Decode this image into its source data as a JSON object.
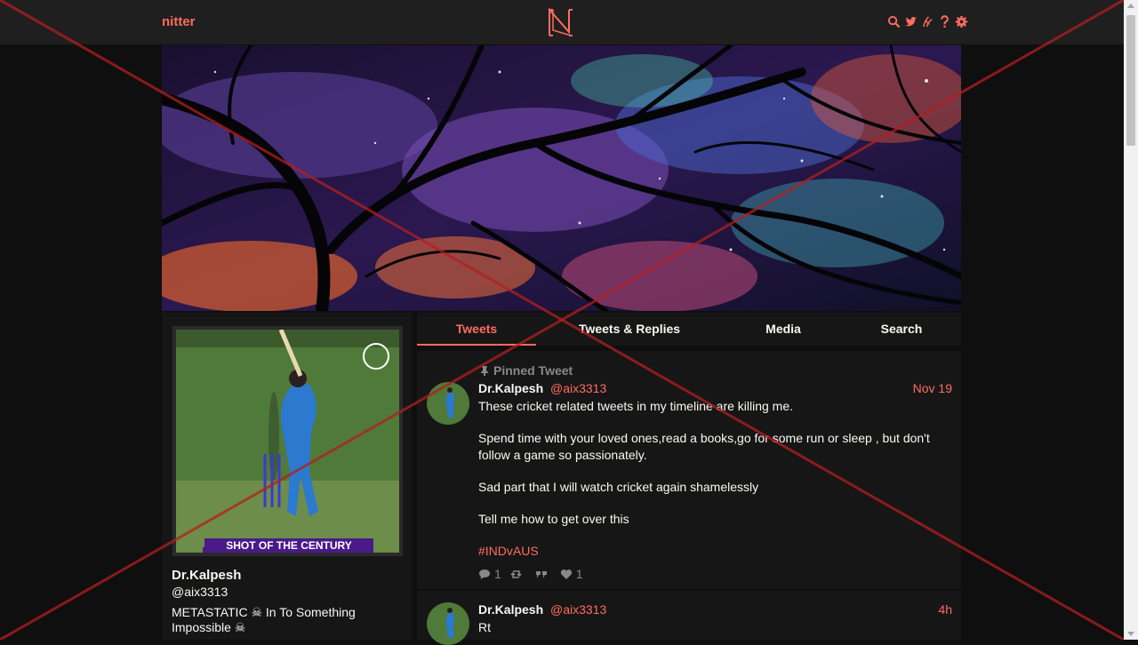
{
  "nav": {
    "brand": "nitter",
    "icons": [
      "search-icon",
      "twitter-icon",
      "rss-icon",
      "help-icon",
      "gear-icon"
    ]
  },
  "profile": {
    "fullname": "Dr.Kalpesh",
    "username": "@aix3313",
    "bio": "METASTATIC ☠ In To Something Impossible ☠",
    "avatar_caption": "SHOT OF THE CENTURY"
  },
  "tabs": [
    {
      "label": "Tweets",
      "active": true
    },
    {
      "label": "Tweets & Replies",
      "active": false
    },
    {
      "label": "Media",
      "active": false
    },
    {
      "label": "Search",
      "active": false
    }
  ],
  "tweets": [
    {
      "pinned_label": "Pinned Tweet",
      "fullname": "Dr.Kalpesh",
      "username": "@aix3313",
      "date": "Nov 19",
      "paragraphs": [
        "These cricket related tweets in my timeline are killing me.",
        "Spend time with your loved ones,read a books,go for some run or sleep , but don't follow a game so passionately.",
        "Sad part that I will watch cricket again shamelessly",
        "Tell me how to get over this"
      ],
      "hashtag": "#INDvAUS",
      "replies": "1",
      "retweets": "",
      "quotes": "",
      "likes": "1"
    },
    {
      "fullname": "Dr.Kalpesh",
      "username": "@aix3313",
      "date": "4h",
      "text": "Rt"
    }
  ],
  "colors": {
    "accent": "#ff6c60",
    "background": "#0f0f0f",
    "panel": "#161616",
    "navbar": "#1f1f1f",
    "muted": "#888889"
  }
}
